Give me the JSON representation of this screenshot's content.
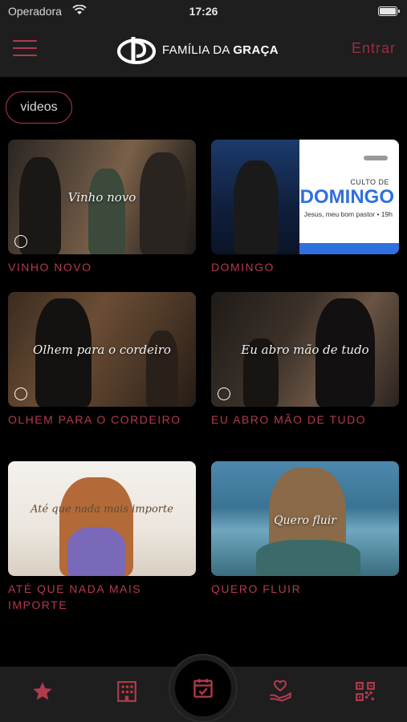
{
  "status_bar": {
    "carrier": "Operadora",
    "time": "17:26"
  },
  "header": {
    "brand_prefix": "FAMÍLIA DA ",
    "brand_bold": "GRAÇA",
    "login_label": "Entrar"
  },
  "filter": {
    "chip_label": "videos"
  },
  "videos": [
    {
      "title": "VINHO NOVO",
      "thumb_caption": "Vinho novo"
    },
    {
      "title": "DOMINGO",
      "thumb_label": "CULTO DE",
      "thumb_title": "DOMINGO",
      "thumb_sub": "Jesus, meu bom pastor • 19h"
    },
    {
      "title": "OLHEM PARA O CORDEIRO",
      "thumb_caption": "Olhem para o cordeiro"
    },
    {
      "title": "EU ABRO MÃO DE TUDO",
      "thumb_caption": "Eu abro mão de tudo"
    },
    {
      "title": "ATÉ QUE NADA MAIS IMPORTE",
      "thumb_caption": "Até que nada mais importe"
    },
    {
      "title": "QUERO FLUIR",
      "thumb_caption": "Quero fluir"
    }
  ],
  "tabbar": {
    "icons": [
      "star-icon",
      "building-icon",
      "calendar-icon",
      "heart-hand-icon",
      "qr-code-icon"
    ],
    "accent": "#b33a4d"
  },
  "colors": {
    "accent": "#b33a4d",
    "login": "#9c2c40",
    "background": "#000000",
    "bar": "#1e1e1e"
  }
}
